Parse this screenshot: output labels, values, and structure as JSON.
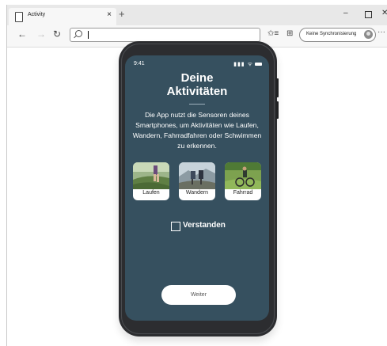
{
  "browser": {
    "tab_title": "Activity",
    "tab_close": "×",
    "new_tab": "+",
    "window_controls": {
      "minimize": "–",
      "close": "✕"
    },
    "nav": {
      "back": "←",
      "forward": "→",
      "reload": "↻",
      "favorites": "✩≡",
      "collections": "⊞",
      "more": "···"
    },
    "address_value": "",
    "sync_label": "Keine Synchronisierung"
  },
  "phone": {
    "status_time": "9:41",
    "status_icons": "▮▮▮ ᯤ",
    "title_line1": "Deine",
    "title_line2": "Aktivitäten",
    "description": "Die App nutzt die Sensoren deines Smartphones, um Aktivitäten wie Laufen, Wandern, Fahrradfahren oder Schwimmen zu erkennen.",
    "activities": [
      {
        "label": "Laufen",
        "image": "running-photo"
      },
      {
        "label": "Wandern",
        "image": "hiking-photo"
      },
      {
        "label": "Fahrrad",
        "image": "cycling-photo"
      }
    ],
    "checkbox_label": "Verstanden",
    "checkbox_checked": false,
    "continue_label": "Weiter"
  },
  "colors": {
    "screen_bg": "#36505f",
    "phone_frame": "#2c2d30",
    "accent_white": "#ffffff"
  }
}
